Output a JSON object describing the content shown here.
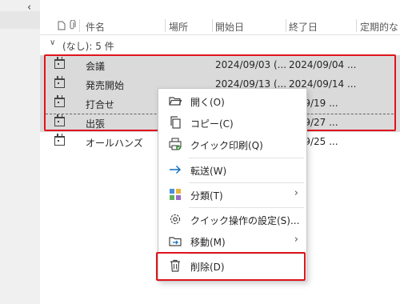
{
  "header": {
    "columns": [
      "件名",
      "場所",
      "開始日",
      "終了日",
      "定期的な"
    ]
  },
  "group": {
    "label": "(なし): 5 件"
  },
  "rows": [
    {
      "subject": "会議",
      "start": "2024/09/03 (...",
      "end": "2024/09/04 ..."
    },
    {
      "subject": "発売開始",
      "start": "2024/09/13 (...",
      "end": "2024/09/14 ..."
    },
    {
      "subject": "打合せ",
      "start": "",
      "end": "4/09/19 ..."
    },
    {
      "subject": "出張",
      "start": "",
      "end": "4/09/27 ..."
    },
    {
      "subject": "オールハンズ",
      "start": "",
      "end": "4/09/25 ..."
    }
  ],
  "context_menu": {
    "open": "開く(O)",
    "copy": "コピー(C)",
    "quick_print": "クイック印刷(Q)",
    "forward": "転送(W)",
    "categorize": "分類(T)",
    "quick_steps": "クイック操作の設定(S)...",
    "move": "移動(M)",
    "delete": "削除(D)"
  },
  "colors": {
    "highlight": "#e0141d",
    "selection": "#dadada",
    "accent": "#0f6cbd"
  }
}
